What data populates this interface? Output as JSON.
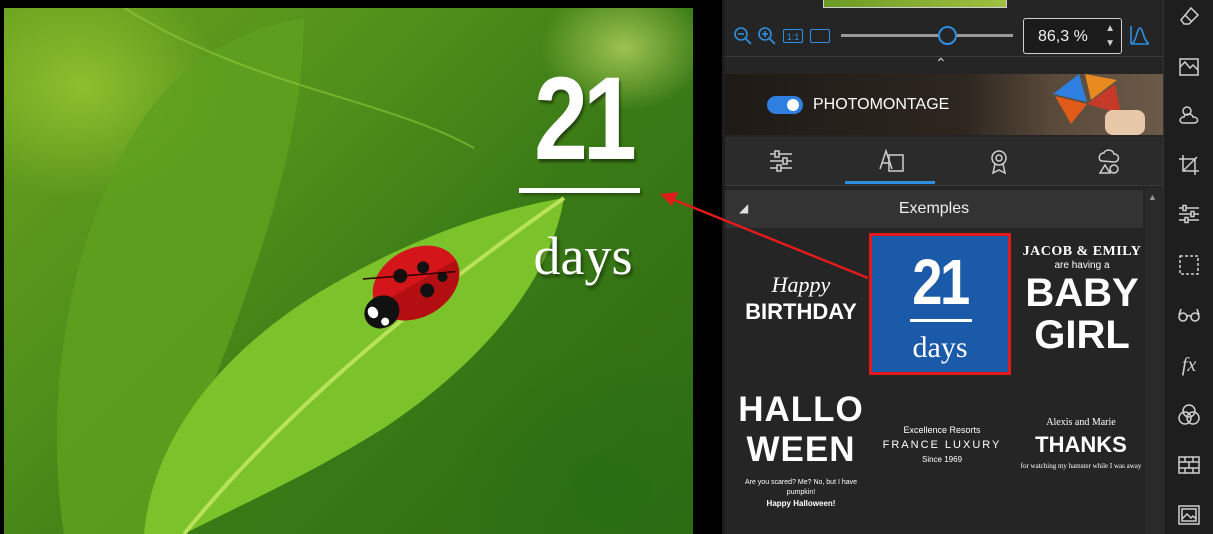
{
  "canvas": {
    "overlay": {
      "number": "21",
      "word": "days"
    }
  },
  "zoom": {
    "value": "86,3 %",
    "slider_level": 0.62,
    "one_to_one_label": "1:1"
  },
  "photomontage": {
    "label": "PHOTOMONTAGE",
    "enabled": true
  },
  "tabs": [
    "adjust",
    "text",
    "badge",
    "shapes"
  ],
  "active_tab": "text",
  "examples": {
    "title": "Exemples",
    "items": {
      "birthday": {
        "line1": "Happy",
        "line2": "BIRTHDAY"
      },
      "days21": {
        "number": "21",
        "word": "days",
        "selected": true
      },
      "baby": {
        "line1": "JACOB & EMILY",
        "line2": "are having a",
        "line3": "BABY",
        "line4": "GIRL"
      },
      "halloween": {
        "line1": "HALLO",
        "line2": "WEEN",
        "line3": "Are you scared? Me? No, but I have pumpkin!",
        "line4": "Happy Halloween!"
      },
      "france": {
        "line1": "Excellence Resorts",
        "line2": "FRANCE LUXURY",
        "line3": "Since 1969"
      },
      "thanks": {
        "line1": "Alexis and Marie",
        "line2": "THANKS",
        "line3": "for watching my hamster while I was away"
      }
    }
  },
  "right_toolbar_icons": [
    "eraser-icon",
    "perspective-icon",
    "weather-icon",
    "crop-icon",
    "sliders-icon",
    "selection-icon",
    "glasses-icon",
    "fx-icon",
    "color-circles-icon",
    "texture-icon",
    "image-icon"
  ],
  "colors": {
    "accent": "#2e8fe0",
    "selection": "#e01b1b",
    "example_bg": "#1a5aa8"
  }
}
